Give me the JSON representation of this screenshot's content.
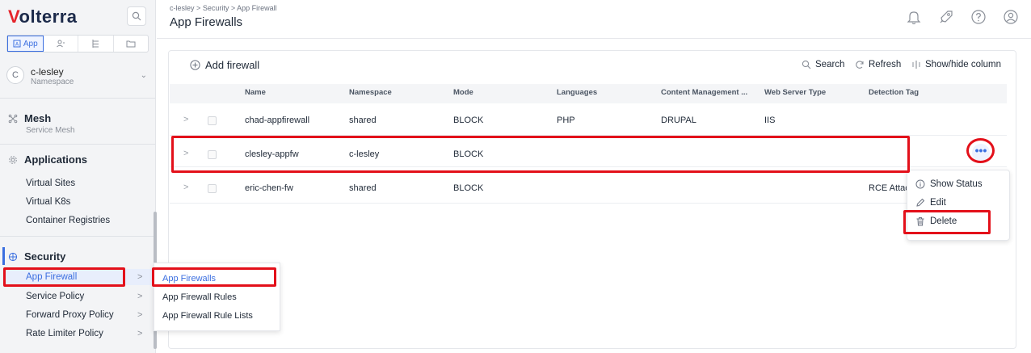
{
  "app": {
    "logo_rest": "olterra",
    "logo_v": "V"
  },
  "workspace_tabs": [
    {
      "label": "App",
      "icon": "app-icon",
      "active": true
    },
    {
      "label": "",
      "icon": "users-icon"
    },
    {
      "label": "",
      "icon": "tree-icon"
    },
    {
      "label": "",
      "icon": "folder-icon"
    }
  ],
  "namespace": {
    "initial": "C",
    "name": "c-lesley",
    "sublabel": "Namespace"
  },
  "sidebar": {
    "mesh": {
      "label": "Mesh",
      "sublabel": "Service Mesh"
    },
    "applications": {
      "label": "Applications",
      "items": [
        "Virtual Sites",
        "Virtual K8s",
        "Container Registries"
      ]
    },
    "security": {
      "label": "Security",
      "items": [
        "App Firewall",
        "Service Policy",
        "Forward Proxy Policy",
        "Rate Limiter Policy"
      ]
    }
  },
  "flyout": {
    "items": [
      "App Firewalls",
      "App Firewall Rules",
      "App Firewall Rule Lists"
    ]
  },
  "breadcrumb": {
    "part1": "c-lesley",
    "sep": ">",
    "part2": "Security",
    "part3": "App Firewall"
  },
  "page_title": "App Firewalls",
  "toolbar": {
    "add_label": "Add firewall",
    "search_label": "Search",
    "refresh_label": "Refresh",
    "columns_label": "Show/hide column"
  },
  "table": {
    "headers": [
      "Name",
      "Namespace",
      "Mode",
      "Languages",
      "Content Management ...",
      "Web Server Type",
      "Detection Tag"
    ],
    "rows": [
      {
        "name": "chad-appfirewall",
        "namespace": "shared",
        "mode": "BLOCK",
        "languages": "PHP",
        "cms": "DRUPAL",
        "web_server": "IIS",
        "detection_tag": ""
      },
      {
        "name": "clesley-appfw",
        "namespace": "c-lesley",
        "mode": "BLOCK",
        "languages": "",
        "cms": "",
        "web_server": "",
        "detection_tag": ""
      },
      {
        "name": "eric-chen-fw",
        "namespace": "shared",
        "mode": "BLOCK",
        "languages": "",
        "cms": "",
        "web_server": "",
        "detection_tag": "RCE Attac"
      }
    ]
  },
  "row_actions": {
    "more_label": "•••",
    "items": [
      "Show Status",
      "Edit",
      "Delete"
    ]
  },
  "colors": {
    "accent": "#3b6fe0",
    "annotation_red": "#e3101a",
    "brand_red": "#e5242b"
  }
}
